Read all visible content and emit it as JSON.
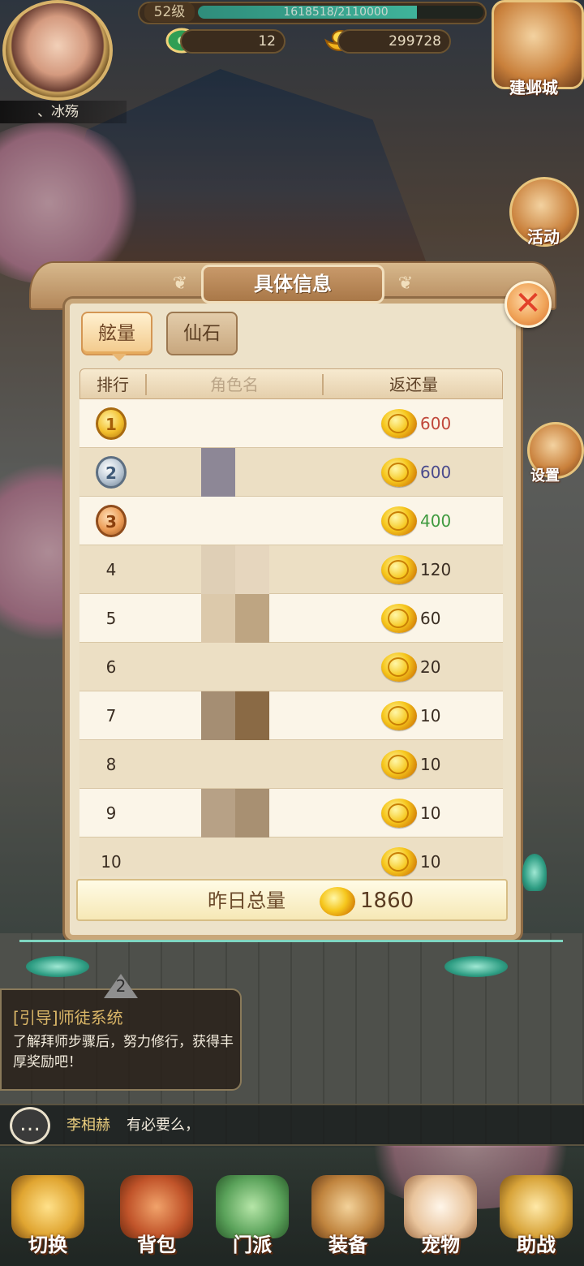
{
  "hud": {
    "level": "52级",
    "exp_text": "1618518/2110000",
    "exp_fraction": 0.7665,
    "jade_count": "12",
    "gold_count": "299728",
    "player_name": "、冰殇"
  },
  "side_buttons": {
    "city": "建邺城",
    "activity": "活动",
    "settings": "设置"
  },
  "panel": {
    "title": "具体信息",
    "tabs": [
      "舷量",
      "仙石"
    ],
    "active_tab": 0,
    "headers": {
      "rank": "排行",
      "name": "角色名",
      "amount": "返还量"
    },
    "rows": [
      {
        "rank": "1",
        "amount": "600",
        "color": "#c0473a"
      },
      {
        "rank": "2",
        "amount": "600",
        "color": "#4a4a8c"
      },
      {
        "rank": "3",
        "amount": "400",
        "color": "#3f9a3f"
      },
      {
        "rank": "4",
        "amount": "120",
        "color": "#3a2d22"
      },
      {
        "rank": "5",
        "amount": "60",
        "color": "#3a2d22"
      },
      {
        "rank": "6",
        "amount": "20",
        "color": "#3a2d22"
      },
      {
        "rank": "7",
        "amount": "10",
        "color": "#3a2d22"
      },
      {
        "rank": "8",
        "amount": "10",
        "color": "#3a2d22"
      },
      {
        "rank": "9",
        "amount": "10",
        "color": "#3a2d22"
      },
      {
        "rank": "10",
        "amount": "10",
        "color": "#3a2d22"
      }
    ],
    "total_label": "昨日总量",
    "total_value": "1860"
  },
  "guide": {
    "badge": "2",
    "title": "[引导]师徒系统",
    "body": "了解拜师步骤后，努力修行，获得丰厚奖励吧！"
  },
  "chat": {
    "name": "李相赫",
    "message": "有必要么，"
  },
  "bottom_nav": [
    "切换",
    "背包",
    "门派",
    "装备",
    "宠物",
    "助战"
  ],
  "colors": {
    "accent": "#c9a77a",
    "coin": "#f6c71d",
    "close": "#e2412a"
  }
}
